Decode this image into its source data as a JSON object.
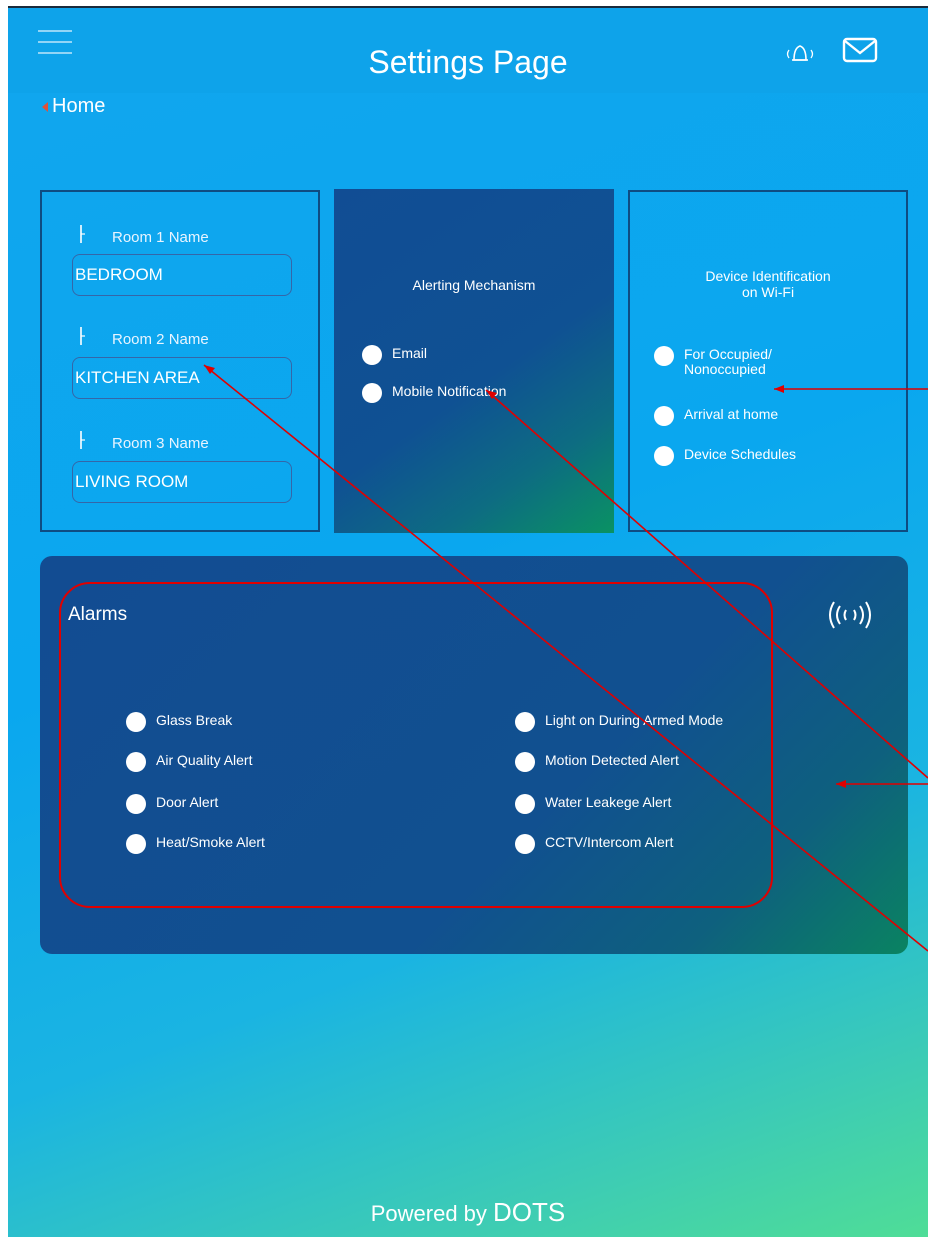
{
  "header": {
    "title": "Settings Page",
    "back_label": "Home",
    "menu_icon": "hamburger-menu-icon",
    "bell_icon": "bell-icon",
    "mail_icon": "mail-icon"
  },
  "rooms": {
    "items": [
      {
        "label": "Room 1 Name",
        "value": "BEDROOM"
      },
      {
        "label": "Room 2 Name",
        "value": "KITCHEN AREA"
      },
      {
        "label": "Room 3 Name",
        "value": "LIVING ROOM"
      }
    ]
  },
  "alerting": {
    "title": "Alerting Mechanism",
    "options": [
      "Email",
      "Mobile Notification"
    ]
  },
  "wifi": {
    "title_line1": "Device Identification",
    "title_line2": "on Wi-Fi",
    "options": [
      {
        "line1": "For Occupied/",
        "line2": "Nonoccupied"
      },
      {
        "line1": "Arrival at home",
        "line2": ""
      },
      {
        "line1": "Device Schedules",
        "line2": ""
      }
    ]
  },
  "alarms": {
    "title": "Alarms",
    "icon": "antenna-signal-icon",
    "left": [
      "Glass Break",
      "Air Quality Alert",
      "Door Alert",
      "Heat/Smoke Alert"
    ],
    "right": [
      "Light on During Armed Mode",
      "Motion Detected Alert",
      "Water Leakege Alert",
      "CCTV/Intercom Alert"
    ]
  },
  "footer": {
    "prefix": "Powered by",
    "brand": "DOTS"
  },
  "colors": {
    "background": "#0ea3ea",
    "panel_dark": "#114d94",
    "annotation": "#e00000"
  }
}
